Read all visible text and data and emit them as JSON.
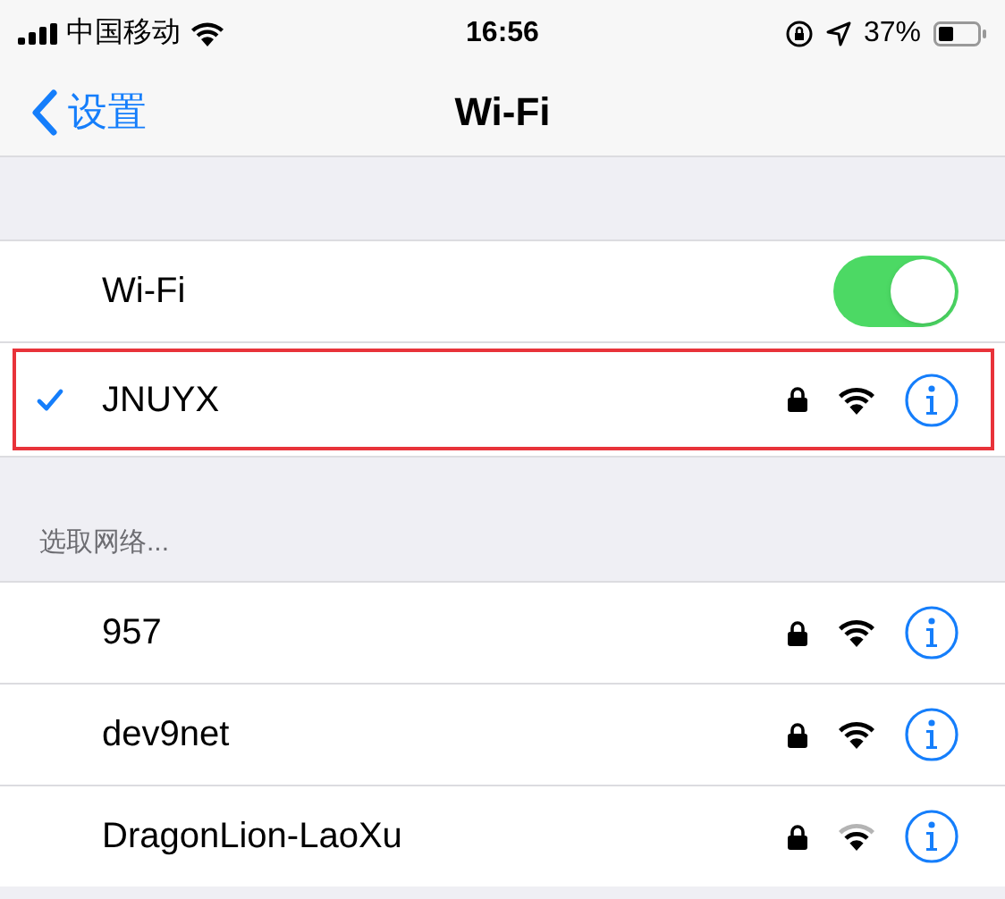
{
  "status_bar": {
    "carrier": "中国移动",
    "time": "16:56",
    "battery": "37%"
  },
  "nav": {
    "back": "设置",
    "title": "Wi-Fi"
  },
  "wifi_toggle": {
    "label": "Wi-Fi",
    "on": true
  },
  "connected": {
    "name": "JNUYX",
    "checked": true,
    "highlighted": true,
    "locked": true,
    "weak_signal": false
  },
  "section_header": "选取网络...",
  "networks": [
    {
      "name": "957",
      "locked": true,
      "weak_signal": false
    },
    {
      "name": "dev9net",
      "locked": true,
      "weak_signal": false
    },
    {
      "name": "DragonLion-LaoXu",
      "locked": true,
      "weak_signal": true
    }
  ]
}
